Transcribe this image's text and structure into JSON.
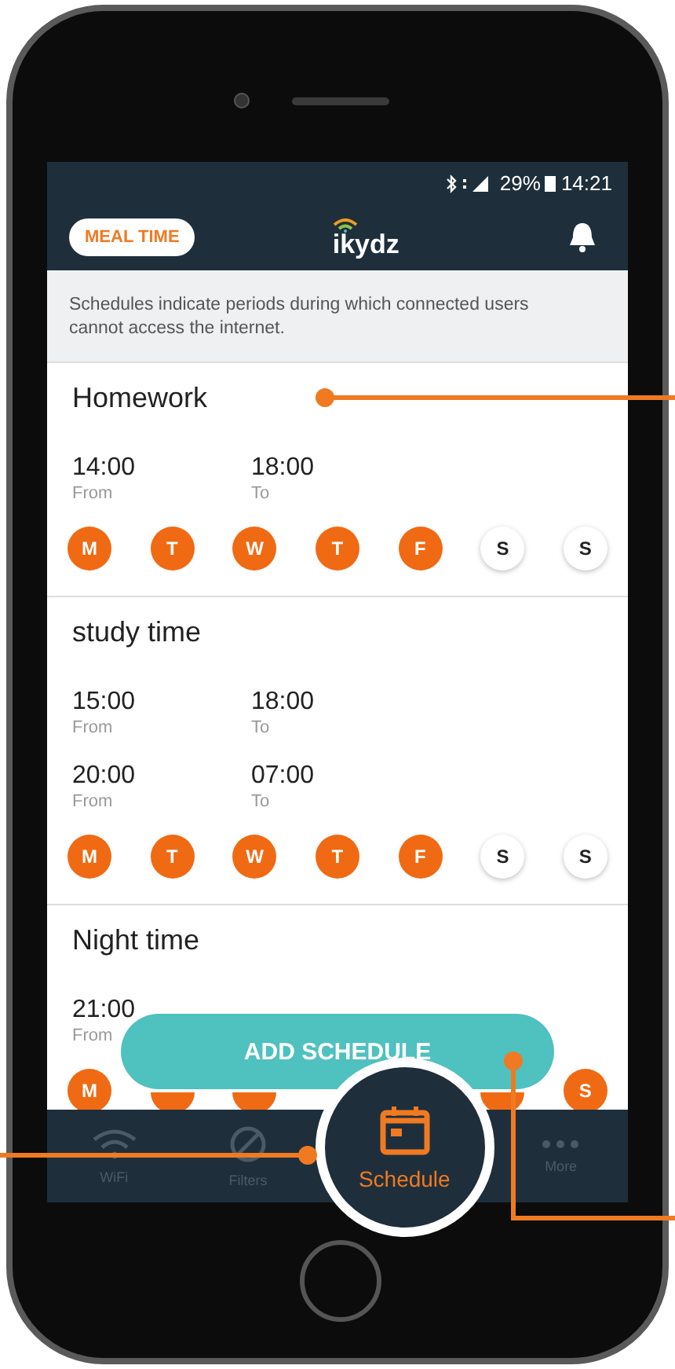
{
  "status_bar": {
    "battery": "29%",
    "time": "14:21"
  },
  "header": {
    "mode_badge": "MEAL TIME",
    "logo": "ikydz"
  },
  "notice": "Schedules indicate periods during which connected users cannot access the internet.",
  "schedules": [
    {
      "name": "Homework",
      "periods": [
        {
          "from": "14:00",
          "from_label": "From",
          "to": "18:00",
          "to_label": "To"
        }
      ],
      "days": [
        {
          "letter": "M",
          "selected": true
        },
        {
          "letter": "T",
          "selected": true
        },
        {
          "letter": "W",
          "selected": true
        },
        {
          "letter": "T",
          "selected": true
        },
        {
          "letter": "F",
          "selected": true
        },
        {
          "letter": "S",
          "selected": false
        },
        {
          "letter": "S",
          "selected": false
        }
      ]
    },
    {
      "name": "study time",
      "periods": [
        {
          "from": "15:00",
          "from_label": "From",
          "to": "18:00",
          "to_label": "To"
        },
        {
          "from": "20:00",
          "from_label": "From",
          "to": "07:00",
          "to_label": "To"
        }
      ],
      "days": [
        {
          "letter": "M",
          "selected": true
        },
        {
          "letter": "T",
          "selected": true
        },
        {
          "letter": "W",
          "selected": true
        },
        {
          "letter": "T",
          "selected": true
        },
        {
          "letter": "F",
          "selected": true
        },
        {
          "letter": "S",
          "selected": false
        },
        {
          "letter": "S",
          "selected": false
        }
      ]
    },
    {
      "name": "Night time",
      "periods": [
        {
          "from": "21:00",
          "from_label": "From"
        }
      ],
      "days": [
        {
          "letter": "M",
          "selected": true
        },
        {
          "selected": true
        },
        {
          "selected": true
        },
        {
          "selected": true
        },
        {
          "letter": "S",
          "selected": true
        }
      ]
    }
  ],
  "add_button": "ADD SCHEDULE",
  "nav": [
    {
      "label": "WiFi",
      "kind": "wifi",
      "selected": false
    },
    {
      "label": "Filters",
      "kind": "filters",
      "selected": false
    },
    {
      "label": "Schedule",
      "kind": "schedule",
      "selected": true
    },
    {
      "label": "More",
      "kind": "more",
      "selected": false
    }
  ]
}
